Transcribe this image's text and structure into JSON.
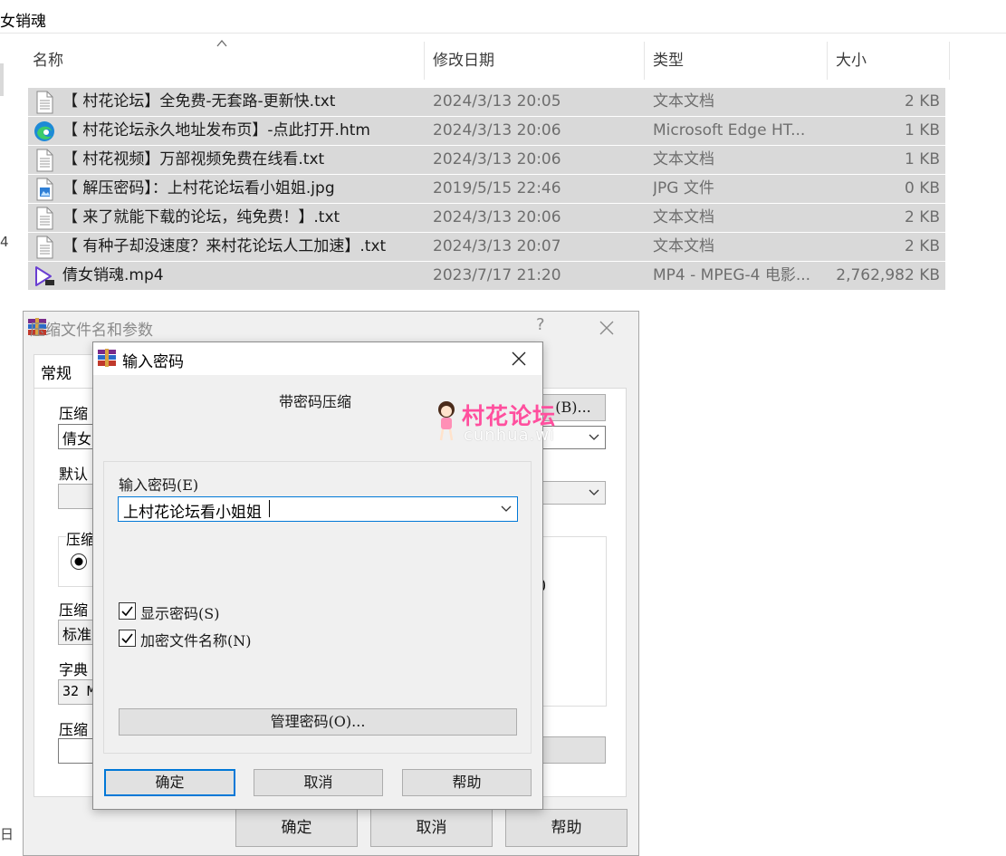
{
  "explorer": {
    "address_text": "女销魂",
    "left_fragments": [
      "4",
      "日"
    ],
    "columns": {
      "name": "名称",
      "date": "修改日期",
      "type": "类型",
      "size": "大小"
    },
    "files": [
      {
        "icon": "text-file-icon",
        "name": "【 村花论坛】全免费-无套路-更新快.txt",
        "date": "2024/3/13 20:05",
        "type": "文本文档",
        "size": "2 KB"
      },
      {
        "icon": "edge-icon",
        "name": "【 村花论坛永久地址发布页】-点此打开.htm",
        "date": "2024/3/13 20:06",
        "type": "Microsoft Edge HT...",
        "size": "1 KB"
      },
      {
        "icon": "text-file-icon",
        "name": "【 村花视频】万部视频免费在线看.txt",
        "date": "2024/3/13 20:06",
        "type": "文本文档",
        "size": "1 KB"
      },
      {
        "icon": "image-file-icon",
        "name": "【 解压密码】：上村花论坛看小姐姐.jpg",
        "date": "2019/5/15 22:46",
        "type": "JPG 文件",
        "size": "0 KB"
      },
      {
        "icon": "text-file-icon",
        "name": "【 来了就能下载的论坛，纯免费！】.txt",
        "date": "2024/3/13 20:06",
        "type": "文本文档",
        "size": "2 KB"
      },
      {
        "icon": "text-file-icon",
        "name": "【 有种子却没速度？来村花论坛人工加速】.txt",
        "date": "2024/3/13 20:07",
        "type": "文本文档",
        "size": "2 KB"
      },
      {
        "icon": "video-file-icon",
        "name": "倩女销魂.mp4",
        "date": "2023/7/17 21:20",
        "type": "MP4 - MPEG-4 电影...",
        "size": "2,762,982 KB"
      }
    ]
  },
  "archive_dialog": {
    "title": "压缩文件名和参数",
    "help_glyph": "?",
    "tab": "常规",
    "labels": [
      "压缩",
      "默认",
      "压缩",
      "压缩",
      "字典",
      "压缩"
    ],
    "field_fragments": {
      "archive_name": "倩女",
      "method": "标准",
      "dict": "32 M"
    },
    "browse_fragment": "(B)...",
    "right_fragment": ")",
    "buttons": {
      "ok": "确定",
      "cancel": "取消",
      "help": "帮助"
    }
  },
  "password_dialog": {
    "title": "输入密码",
    "heading": "带密码压缩",
    "field_label": "输入密码(E)",
    "password_value": "上村花论坛看小姐姐",
    "show_password": {
      "label": "显示密码(S)",
      "checked": true
    },
    "encrypt_names": {
      "label": "加密文件名称(N)",
      "checked": true
    },
    "manage_button": "管理密码(O)...",
    "buttons": {
      "ok": "确定",
      "cancel": "取消",
      "help": "帮助"
    }
  },
  "watermark": {
    "text": "村花论坛",
    "subtext": "cunhua.wi"
  },
  "colors": {
    "selection": "#d9d9d9",
    "dialog_bg": "#f0f0f0",
    "accent": "#0078d7",
    "watermark": "#ff4f9e"
  }
}
